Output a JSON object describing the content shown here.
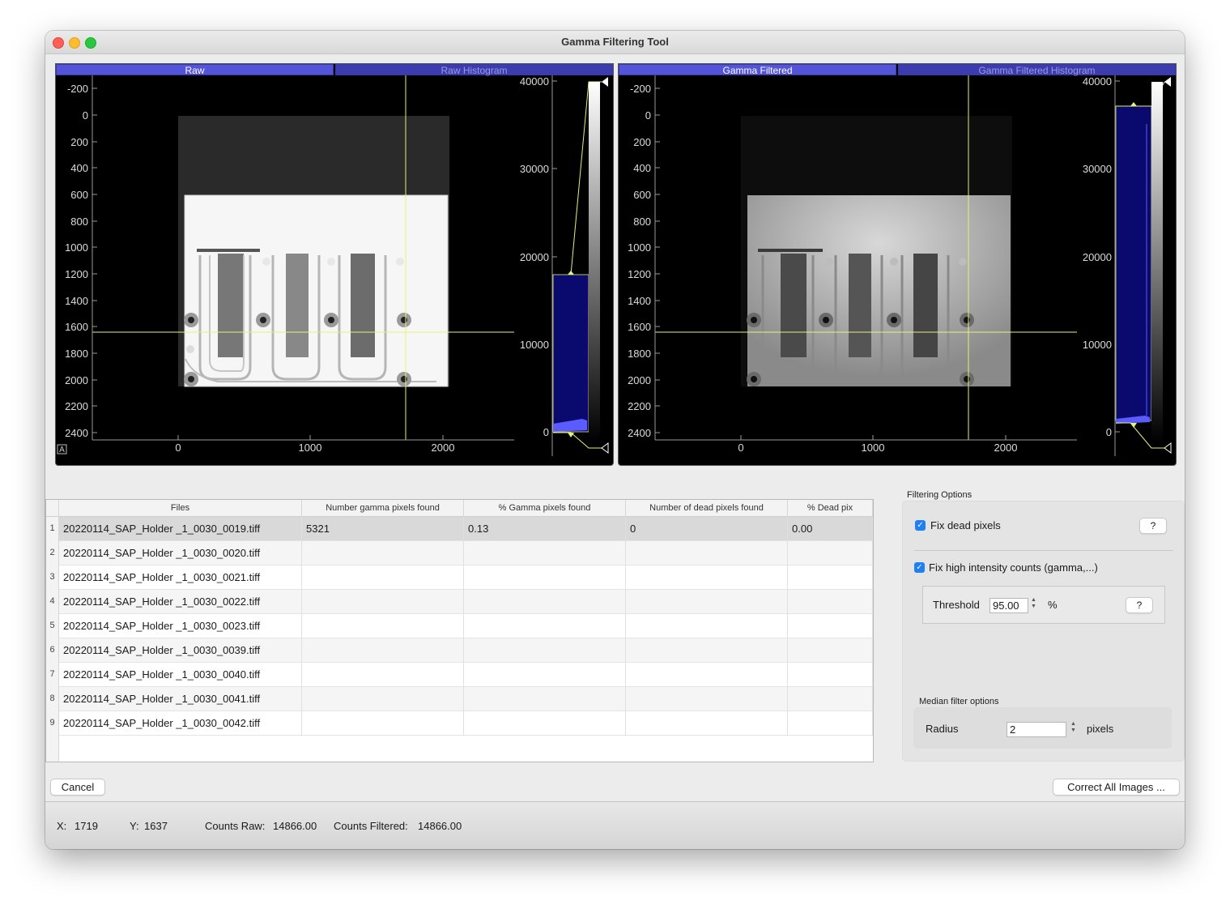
{
  "window": {
    "title": "Gamma Filtering Tool"
  },
  "left_panel": {
    "tabs": [
      "Raw",
      "Raw Histogram"
    ],
    "y_ticks": [
      "-200",
      "0",
      "200",
      "400",
      "600",
      "800",
      "1000",
      "1200",
      "1400",
      "1600",
      "1800",
      "2000",
      "2200",
      "2400"
    ],
    "x_ticks": [
      "0",
      "1000",
      "2000"
    ],
    "hist_ticks": [
      "40000",
      "30000",
      "20000",
      "10000",
      "0"
    ],
    "corner_button": "A"
  },
  "right_panel": {
    "tabs": [
      "Gamma Filtered",
      "Gamma Filtered Histogram"
    ],
    "y_ticks": [
      "-200",
      "0",
      "200",
      "400",
      "600",
      "800",
      "1000",
      "1200",
      "1400",
      "1600",
      "1800",
      "2000",
      "2200",
      "2400"
    ],
    "x_ticks": [
      "0",
      "1000",
      "2000"
    ],
    "hist_ticks": [
      "40000",
      "30000",
      "20000",
      "10000",
      "0"
    ]
  },
  "table": {
    "headers": [
      "Files",
      "Number gamma pixels found",
      "% Gamma pixels found",
      "Number of dead pixels found",
      "% Dead pix"
    ],
    "rows": [
      {
        "num": "1",
        "file": "20220114_SAP_Holder _1_0030_0019.tiff",
        "gamma": "5321",
        "gamma_pct": "0.13",
        "dead": "0",
        "dead_pct": "0.00"
      },
      {
        "num": "2",
        "file": "20220114_SAP_Holder _1_0030_0020.tiff",
        "gamma": "",
        "gamma_pct": "",
        "dead": "",
        "dead_pct": ""
      },
      {
        "num": "3",
        "file": "20220114_SAP_Holder _1_0030_0021.tiff",
        "gamma": "",
        "gamma_pct": "",
        "dead": "",
        "dead_pct": ""
      },
      {
        "num": "4",
        "file": "20220114_SAP_Holder _1_0030_0022.tiff",
        "gamma": "",
        "gamma_pct": "",
        "dead": "",
        "dead_pct": ""
      },
      {
        "num": "5",
        "file": "20220114_SAP_Holder _1_0030_0023.tiff",
        "gamma": "",
        "gamma_pct": "",
        "dead": "",
        "dead_pct": ""
      },
      {
        "num": "6",
        "file": "20220114_SAP_Holder _1_0030_0039.tiff",
        "gamma": "",
        "gamma_pct": "",
        "dead": "",
        "dead_pct": ""
      },
      {
        "num": "7",
        "file": "20220114_SAP_Holder _1_0030_0040.tiff",
        "gamma": "",
        "gamma_pct": "",
        "dead": "",
        "dead_pct": ""
      },
      {
        "num": "8",
        "file": "20220114_SAP_Holder _1_0030_0041.tiff",
        "gamma": "",
        "gamma_pct": "",
        "dead": "",
        "dead_pct": ""
      },
      {
        "num": "9",
        "file": "20220114_SAP_Holder _1_0030_0042.tiff",
        "gamma": "",
        "gamma_pct": "",
        "dead": "",
        "dead_pct": ""
      }
    ]
  },
  "filtering_options": {
    "title": "Filtering Options",
    "fix_dead_label": "Fix dead pixels",
    "fix_dead_checked": true,
    "fix_high_label": "Fix high intensity counts (gamma,...)",
    "fix_high_checked": true,
    "help_label": "?",
    "threshold_label": "Threshold",
    "threshold_value": "95.00",
    "threshold_unit": "%"
  },
  "median_filter": {
    "title": "Median filter options",
    "radius_label": "Radius",
    "radius_value": "2",
    "radius_unit": "pixels"
  },
  "buttons": {
    "cancel": "Cancel",
    "correct_all": "Correct All Images ..."
  },
  "status": {
    "x_label": "X:",
    "x_value": "1719",
    "y_label": "Y:",
    "y_value": "1637",
    "counts_raw_label": "Counts Raw:",
    "counts_raw_value": "14866.00",
    "counts_filtered_label": "Counts Filtered:",
    "counts_filtered_value": "14866.00"
  },
  "colors": {
    "tab_blue": "#5454d8",
    "crosshair": "#e6f07a",
    "histogram_fill": "#0a0a6e",
    "accent": "#1f7ff3"
  }
}
